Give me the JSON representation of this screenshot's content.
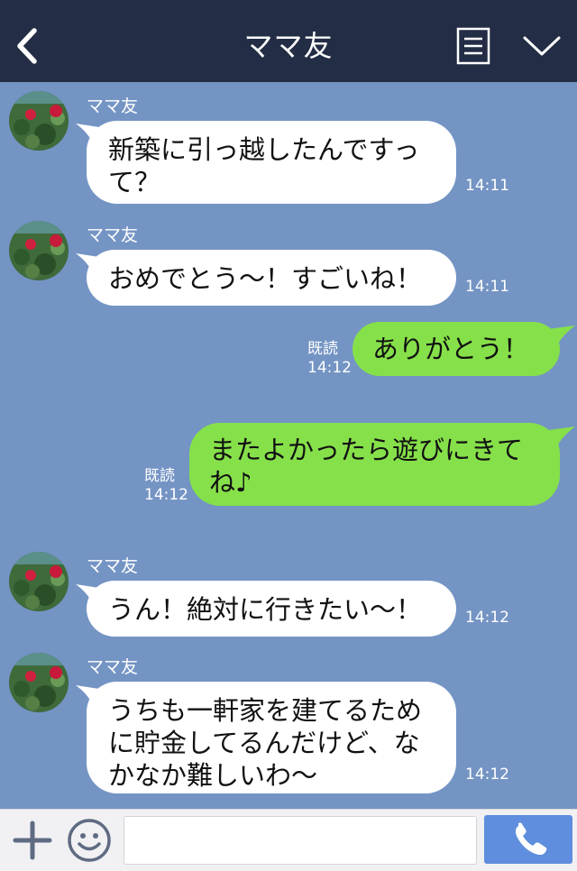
{
  "header": {
    "title": "ママ友",
    "back_icon": "chevron-left-icon",
    "menu_icon": "menu-list-icon",
    "dropdown_icon": "chevron-down-icon",
    "background": "#232d45"
  },
  "chat": {
    "background": "#7494c4",
    "messages": [
      {
        "direction": "in",
        "sender": "ママ友",
        "lines": [
          "新築に引っ越したんですっ",
          "て？"
        ],
        "time": "14:11"
      },
      {
        "direction": "in",
        "sender": "ママ友",
        "lines": [
          "おめでとう〜！すごいね！"
        ],
        "time": "14:11"
      },
      {
        "direction": "out",
        "lines": [
          "ありがとう！"
        ],
        "read": "既読",
        "time": "14:12"
      },
      {
        "direction": "out",
        "lines": [
          "またよかったら遊びにきて",
          "ね♪"
        ],
        "read": "既読",
        "time": "14:12"
      },
      {
        "direction": "in",
        "sender": "ママ友",
        "lines": [
          "うん！絶対に行きたい〜！"
        ],
        "time": "14:12"
      },
      {
        "direction": "in",
        "sender": "ママ友",
        "lines": [
          "うちも一軒家を建てるため",
          "に貯金してるんだけど、な",
          "かなか難しいわ〜"
        ],
        "time": "14:12"
      }
    ]
  },
  "footer": {
    "plus_icon": "plus-icon",
    "emoji_icon": "smiley-icon",
    "input_value": "",
    "call_icon": "phone-icon",
    "call_color": "#5e8edd"
  },
  "colors": {
    "incoming_bubble": "#ffffff",
    "outgoing_bubble": "#86e04a"
  }
}
